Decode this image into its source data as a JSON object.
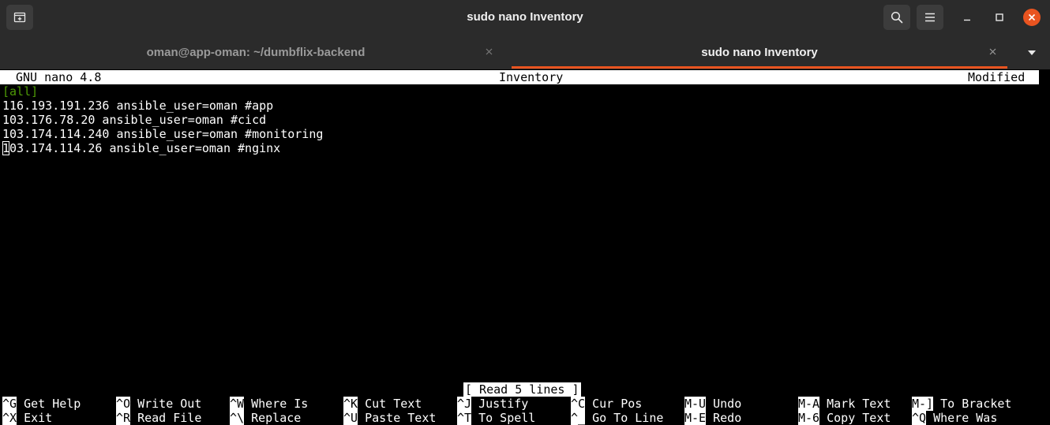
{
  "window": {
    "title": "sudo nano Inventory"
  },
  "tabs": [
    {
      "label": "oman@app-oman: ~/dumbflix-backend",
      "active": false
    },
    {
      "label": "sudo nano Inventory",
      "active": true
    }
  ],
  "nano": {
    "version": "GNU nano 4.8",
    "filename": "Inventory",
    "state": "Modified",
    "lines": [
      "[all]",
      "116.193.191.236 ansible_user=oman #app",
      "103.176.78.20 ansible_user=oman #cicd",
      "103.174.114.240 ansible_user=oman #monitoring",
      "03.174.114.26 ansible_user=oman #nginx"
    ],
    "cursor_char": "1",
    "message": "[ Read 5 lines ]",
    "shortcuts_row1": [
      {
        "key": "^G",
        "label": "Get Help"
      },
      {
        "key": "^O",
        "label": "Write Out"
      },
      {
        "key": "^W",
        "label": "Where Is"
      },
      {
        "key": "^K",
        "label": "Cut Text"
      },
      {
        "key": "^J",
        "label": "Justify"
      },
      {
        "key": "^C",
        "label": "Cur Pos"
      },
      {
        "key": "M-U",
        "label": "Undo"
      },
      {
        "key": "M-A",
        "label": "Mark Text"
      },
      {
        "key": "M-]",
        "label": "To Bracket"
      }
    ],
    "shortcuts_row2": [
      {
        "key": "^X",
        "label": "Exit"
      },
      {
        "key": "^R",
        "label": "Read File"
      },
      {
        "key": "^\\",
        "label": "Replace"
      },
      {
        "key": "^U",
        "label": "Paste Text"
      },
      {
        "key": "^T",
        "label": "To Spell"
      },
      {
        "key": "^_",
        "label": "Go To Line"
      },
      {
        "key": "M-E",
        "label": "Redo"
      },
      {
        "key": "M-6",
        "label": "Copy Text"
      },
      {
        "key": "^Q",
        "label": "Where Was"
      }
    ]
  },
  "colors": {
    "accent": "#e95420",
    "section_header": "#4e9a06",
    "header_bg": "#2b2b2b",
    "terminal_bg": "#000000",
    "terminal_fg": "#ffffff"
  },
  "icons": {
    "new_tab": "new-tab-icon",
    "search": "search-icon",
    "menu": "hamburger-menu-icon",
    "minimize": "minimize-icon",
    "maximize": "maximize-icon",
    "close": "close-icon"
  }
}
